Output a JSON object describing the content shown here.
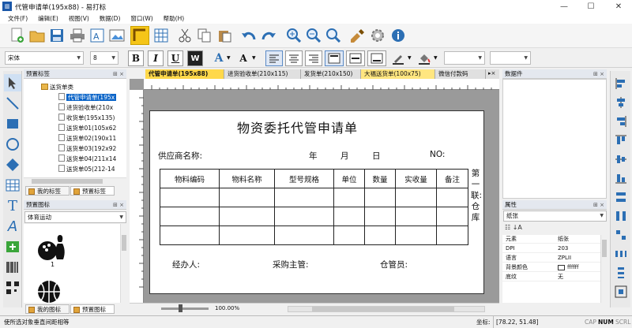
{
  "window": {
    "title": "代管申请单(195x88) - 易打标"
  },
  "menu": [
    "文件(F)",
    "编辑(E)",
    "视图(V)",
    "数据(D)",
    "窗口(W)",
    "帮助(H)"
  ],
  "font_toolbar": {
    "font_name": "宋体",
    "font_size": "8"
  },
  "left_panel": {
    "template_header": "预置标签",
    "tree_root": "送货单类",
    "tree_items": [
      "代管申请单(195x",
      "进货验收单(210x",
      "收货单(195x135)",
      "送货单01(105x62",
      "送货单02(190x11",
      "送货单03(192x92",
      "送货单04(211x14",
      "送货单05(212-14"
    ],
    "tabs": [
      "我的标签",
      "预置标签"
    ],
    "icon_header": "预置图标",
    "icon_category": "体育运动",
    "icon_number": "1",
    "icon_tabs": [
      "我的图标",
      "预置图标"
    ]
  },
  "doc_tabs": [
    "代管申请单(195x88)",
    "进货验收单(210x115)",
    "发货单(210x150)",
    "大福送货单(100x75)",
    "微信付款码"
  ],
  "document": {
    "title": "物资委托代管申请单",
    "supplier_label": "供应商名称:",
    "year": "年",
    "month": "月",
    "day": "日",
    "no_label": "NO:",
    "columns": [
      "物料编码",
      "物料名称",
      "型号规格",
      "单位",
      "数量",
      "实收量",
      "备注"
    ],
    "side_label": "第一联:仓库",
    "handler": "经办人:",
    "purchaser": "采购主管:",
    "warehouse_keeper": "仓管员:"
  },
  "zoom": "100.00%",
  "right_panel": {
    "data_header": "数据件",
    "props_header": "属性",
    "props_combo": "纸张",
    "props": [
      {
        "k": "元素",
        "v": "纸张"
      },
      {
        "k": "DPI",
        "v": "203"
      },
      {
        "k": "语言",
        "v": "ZPLII"
      },
      {
        "k": "背景颜色",
        "v": "ffffff"
      },
      {
        "k": "底纹",
        "v": "无"
      }
    ]
  },
  "status": {
    "hint": "使所选对象垂直间距相等",
    "coord_label": "坐标:",
    "coord_value": "[78.22, 51.48]",
    "caps": "CAP",
    "num": "NUM",
    "scrl": "SCRL"
  },
  "colors": {
    "accent": "#0a64c8",
    "active_tab": "#f5c518",
    "doc_active_tab": "#ffd84a"
  }
}
